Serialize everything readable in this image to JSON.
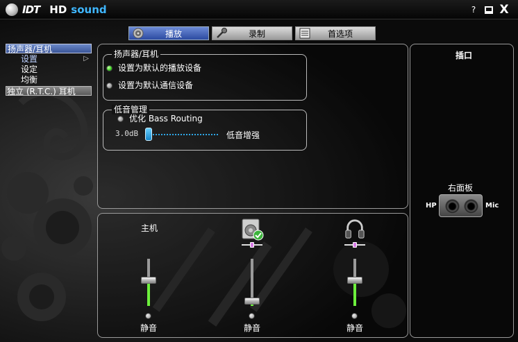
{
  "titlebar": {
    "logo_brand": "IDT",
    "logo_hd": "HD",
    "logo_sound": "sound",
    "help": "?",
    "close": "X"
  },
  "tabs": [
    {
      "label": "播放",
      "icon": "speaker-icon",
      "active": true
    },
    {
      "label": "录制",
      "icon": "microphone-icon",
      "active": false
    },
    {
      "label": "首选项",
      "icon": "list-icon",
      "active": false
    }
  ],
  "sidebar": {
    "heading": "扬声器/耳机",
    "items": [
      {
        "label": "设置",
        "selected": true,
        "arrow": "▷"
      },
      {
        "label": "设定",
        "selected": false
      },
      {
        "label": "均衡",
        "selected": false
      }
    ],
    "heading2": "独立 (R.T.C.) 耳机"
  },
  "speaker_group": {
    "legend": "扬声器/耳机",
    "options": [
      {
        "label": "设置为默认的播放设备",
        "on": true
      },
      {
        "label": "设置为默认通信设备",
        "on": false
      }
    ]
  },
  "bass_group": {
    "legend": "低音管理",
    "optimize": "优化 Bass Routing",
    "value": "3.0dB",
    "boost_label": "低音增强",
    "level_fraction": 0.0
  },
  "mixer": {
    "channels": [
      {
        "name": "主机",
        "level": 0.55,
        "mute": "静音",
        "icon": null
      },
      {
        "name": "",
        "level": 0.1,
        "mute": "静音",
        "icon": "speaker-default-icon"
      },
      {
        "name": "",
        "level": 0.55,
        "mute": "静音",
        "icon": "headphone-icon"
      }
    ]
  },
  "jacks": {
    "title": "插口",
    "panel_label": "右面板",
    "hp": "HP",
    "mic": "Mic"
  },
  "colors": {
    "accent_blue": "#3fb7ff",
    "level_green": "#6df03c",
    "tab_active": "#3c5bb0"
  }
}
